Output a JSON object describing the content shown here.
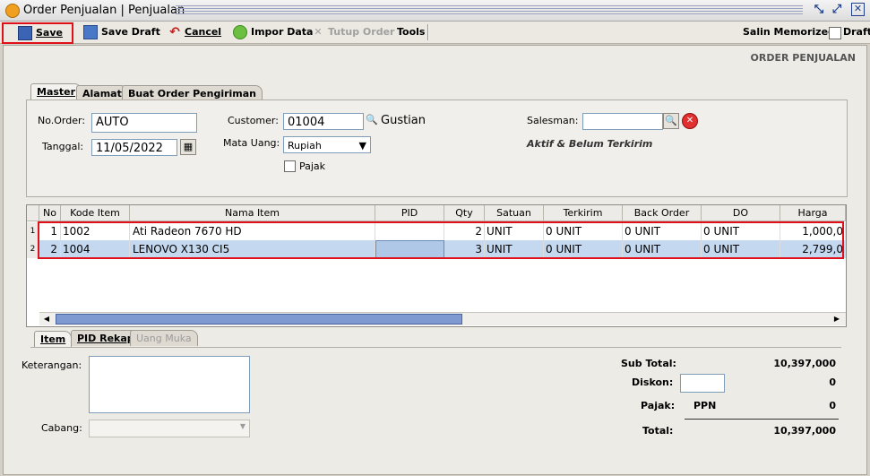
{
  "window": {
    "title": "Order Penjualan | Penjualan"
  },
  "toolbar": {
    "save": "Save",
    "save_draft": "Save Draft",
    "cancel": "Cancel",
    "impor_data": "Impor Data",
    "tutup_order": "Tutup Order",
    "tools": "Tools",
    "salin_memorized": "Salin Memorized",
    "draft": "Draft"
  },
  "page_header": "ORDER PENJUALAN",
  "tabs": [
    "Master",
    "Alamat",
    "Buat Order Pengiriman"
  ],
  "master": {
    "no_order_label": "No.Order:",
    "no_order_value": "AUTO",
    "tanggal_label": "Tanggal:",
    "tanggal_value": "11/05/2022",
    "customer_label": "Customer:",
    "customer_code": "01004",
    "customer_name": "Gustian",
    "mata_uang_label": "Mata Uang:",
    "mata_uang_value": "Rupiah",
    "pajak_label": "Pajak",
    "salesman_label": "Salesman:",
    "salesman_value": "",
    "status": "Aktif & Belum Terkirim"
  },
  "grid": {
    "columns": [
      "No",
      "Kode Item",
      "Nama Item",
      "PID",
      "Qty",
      "Satuan",
      "Terkirim",
      "Back Order",
      "DO",
      "Harga"
    ],
    "rows": [
      {
        "idx": "1",
        "no": "1",
        "kode": "1002",
        "nama": "Ati Radeon 7670 HD",
        "pid": "",
        "qty": "2",
        "satuan": "UNIT",
        "terkirim": "0 UNIT",
        "back_order": "0 UNIT",
        "do": "0 UNIT",
        "harga": "1,000,0"
      },
      {
        "idx": "2",
        "no": "2",
        "kode": "1004",
        "nama": "LENOVO X130 CI5",
        "pid": "",
        "qty": "3",
        "satuan": "UNIT",
        "terkirim": "0 UNIT",
        "back_order": "0 UNIT",
        "do": "0 UNIT",
        "harga": "2,799,0"
      }
    ]
  },
  "bottom_tabs": [
    "Item",
    "PID Rekap",
    "Uang Muka"
  ],
  "keterangan_label": "Keterangan:",
  "keterangan_value": "",
  "cabang_label": "Cabang:",
  "totals": {
    "sub_total_label": "Sub Total:",
    "sub_total": "10,397,000",
    "diskon_label": "Diskon:",
    "diskon_value": "0",
    "pajak_label": "Pajak:",
    "pajak_type": "PPN",
    "pajak_value": "0",
    "total_label": "Total:",
    "total": "10,397,000"
  }
}
